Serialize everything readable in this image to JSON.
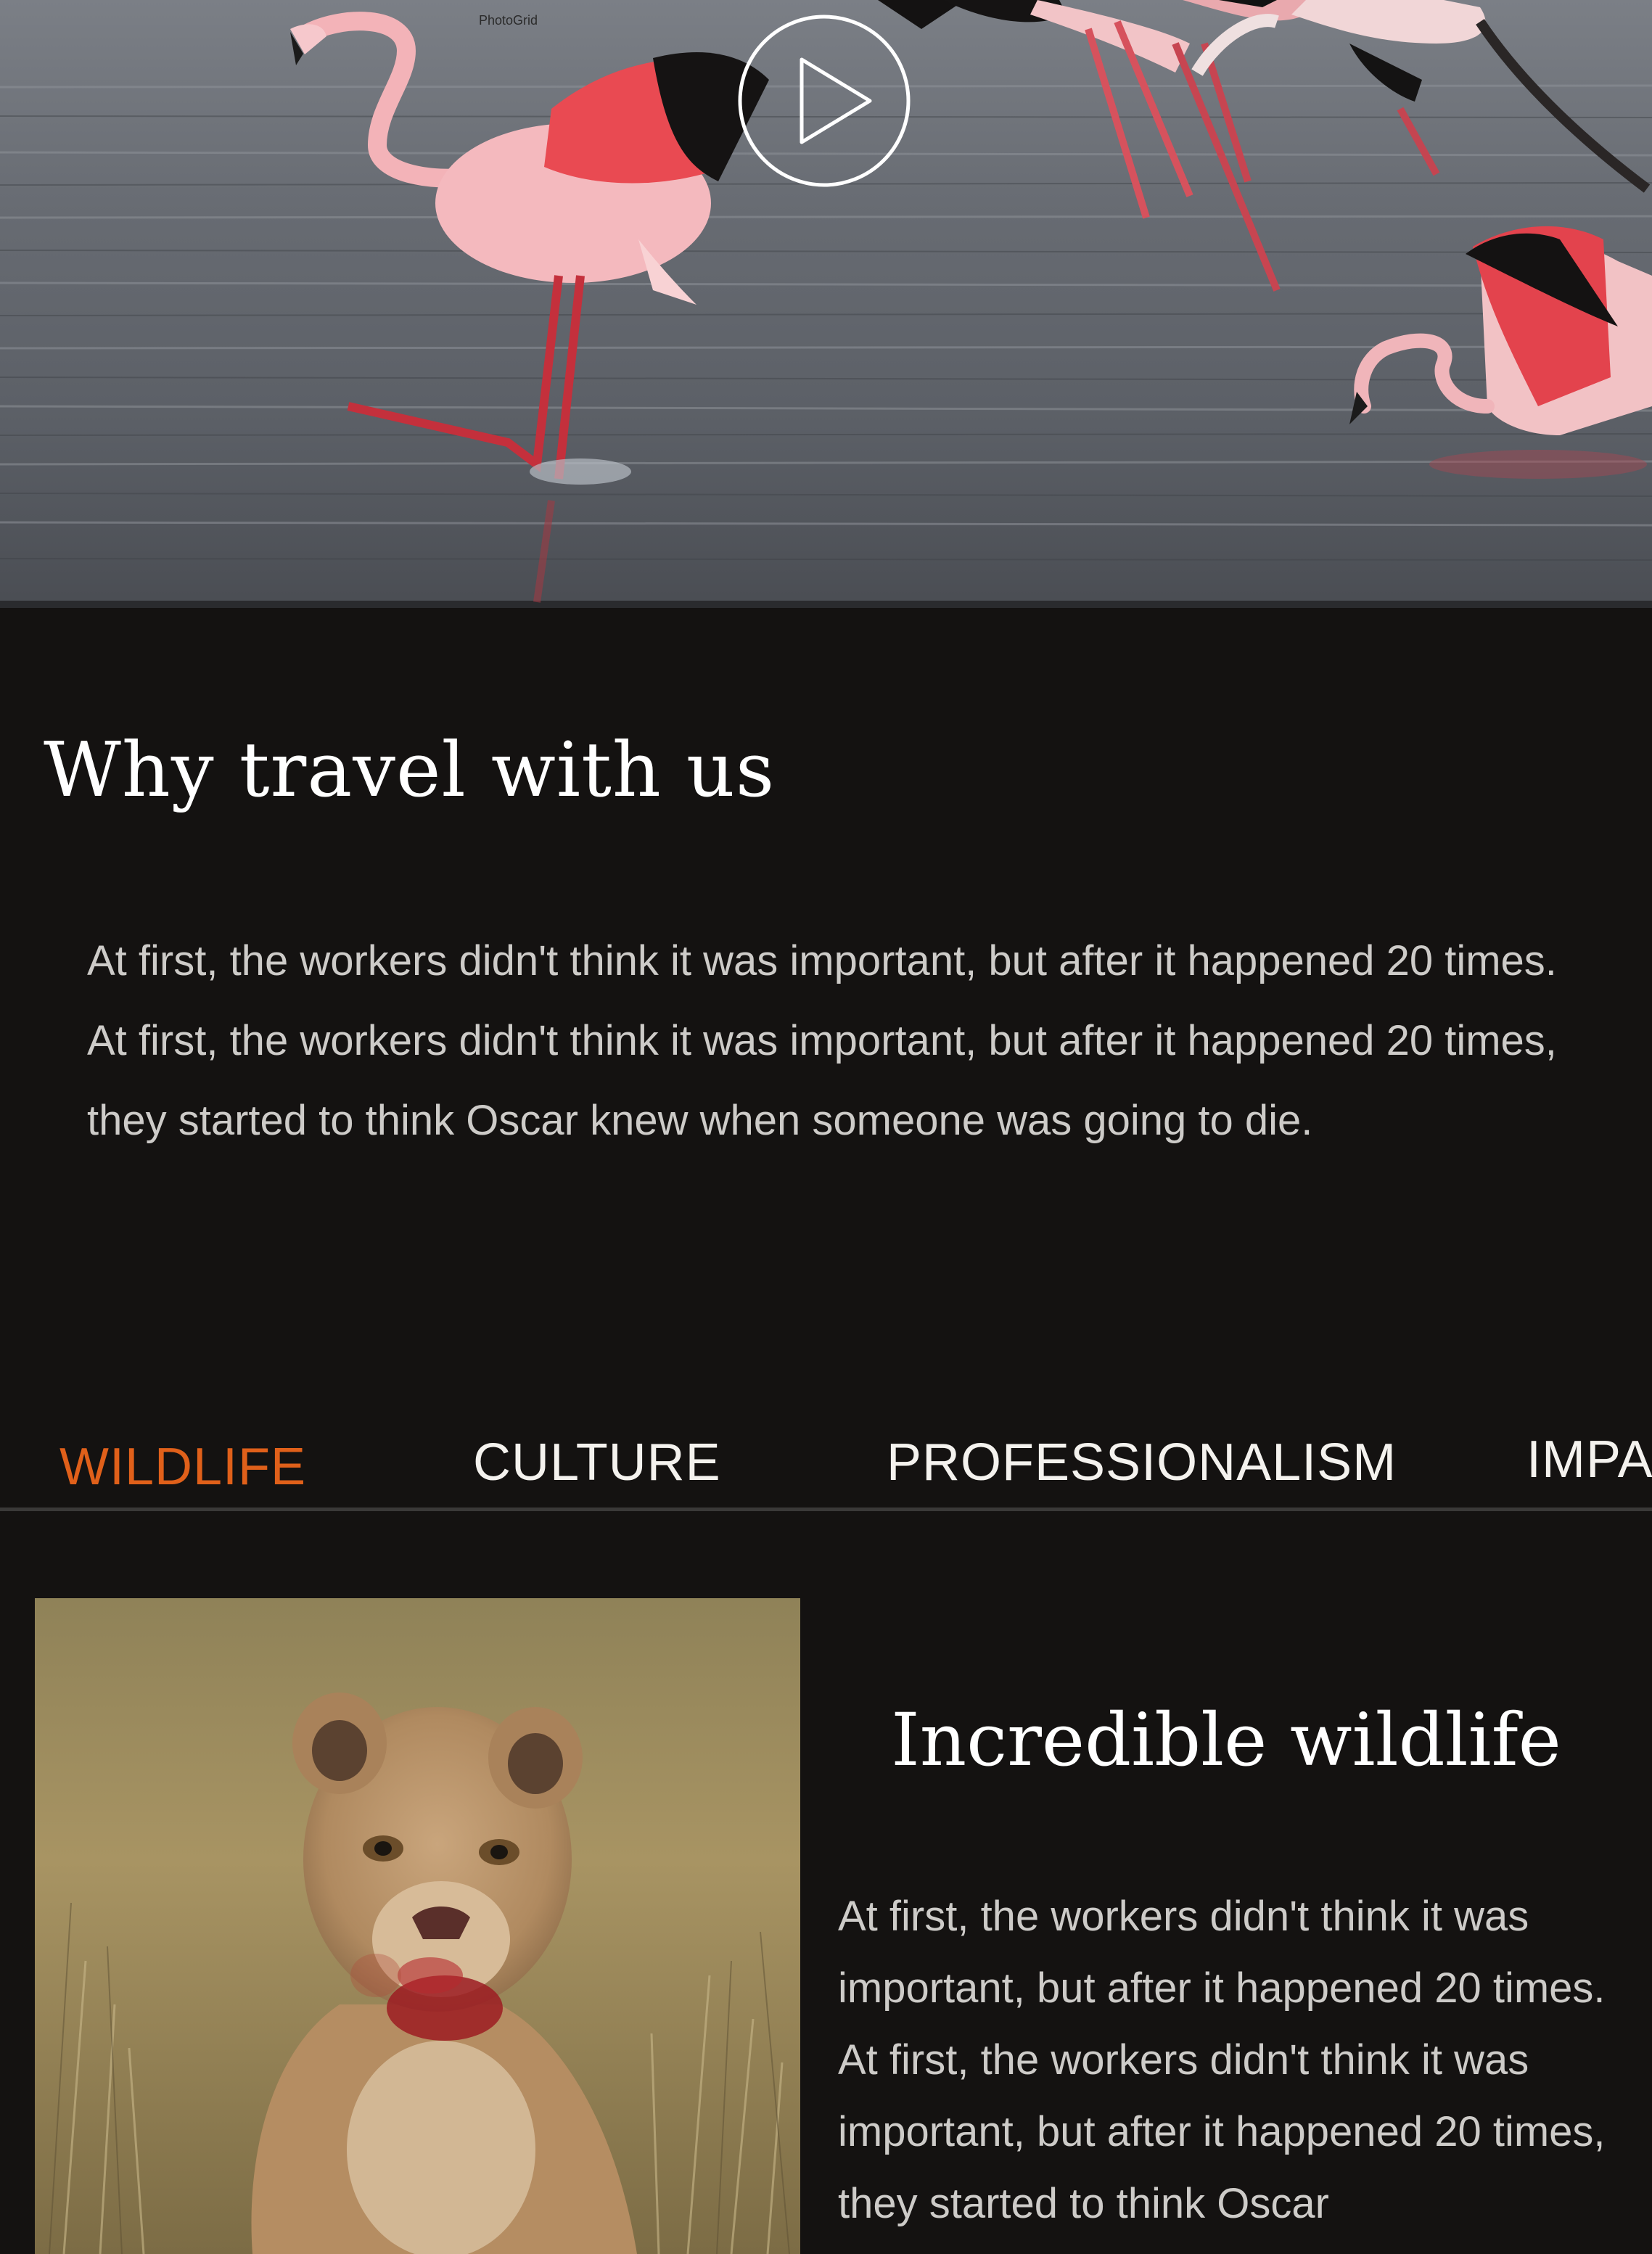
{
  "hero": {
    "watermark": "PhotoGrid",
    "play_icon": "play-icon"
  },
  "why": {
    "title": "Why travel with us",
    "body": "At first, the workers didn't think it was important, but after it happened 20 times. At first, the workers didn't think it was important, but after it happened 20 times, they started to think Oscar knew when someone was going to die."
  },
  "tabs": {
    "items": [
      {
        "label": "WILDLIFE",
        "active": true
      },
      {
        "label": "CULTURE",
        "active": false
      },
      {
        "label": "PROFESSIONALISM",
        "active": false
      },
      {
        "label": "IMPA",
        "active": false
      }
    ]
  },
  "feature": {
    "title": "Incredible wildlife",
    "body": "At first, the workers didn't think it was important, but after it happened 20 times. At first, the workers didn't think it was important, but after it happened 20 times, they started to think Oscar"
  },
  "colors": {
    "background": "#141211",
    "accent": "#e0601a",
    "body_text": "#cdcbc8",
    "divider": "#3a3938"
  }
}
